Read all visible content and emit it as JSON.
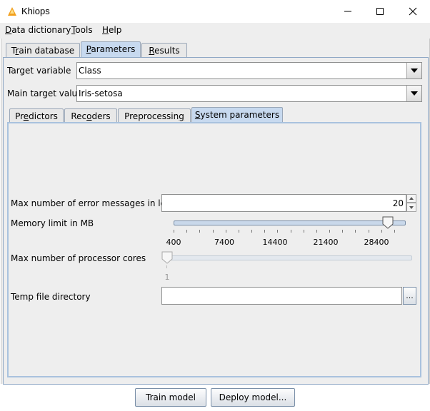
{
  "window": {
    "title": "Khiops",
    "icon": "khiops-logo-icon"
  },
  "window_controls": {
    "minimize": "minimize-icon",
    "maximize": "maximize-icon",
    "close": "close-icon"
  },
  "menubar": {
    "data_dictionary": {
      "mnemonic": "D",
      "rest": "ata dictionary"
    },
    "tools": {
      "mnemonic": "T",
      "rest": "ools"
    },
    "help": {
      "mnemonic": "H",
      "rest": "elp"
    }
  },
  "main_tabs": [
    {
      "pre": "T",
      "mn": "r",
      "post": "ain database",
      "active": false
    },
    {
      "pre": "",
      "mn": "P",
      "post": "arameters",
      "active": true
    },
    {
      "pre": "",
      "mn": "R",
      "post": "esults",
      "active": false
    }
  ],
  "target_variable": {
    "label": "Target variable",
    "value": "Class"
  },
  "main_target_value": {
    "label": "Main target value",
    "value": "Iris-setosa"
  },
  "sub_tabs": [
    {
      "pre": "Pr",
      "mn": "e",
      "post": "dictors",
      "active": false
    },
    {
      "pre": "Rec",
      "mn": "o",
      "post": "ders",
      "active": false
    },
    {
      "pre": "Preprocessin",
      "mn": "g",
      "post": "",
      "active": false
    },
    {
      "pre": "",
      "mn": "S",
      "post": "ystem parameters",
      "active": true
    }
  ],
  "system_parameters": {
    "max_error_messages": {
      "label": "Max number of error messages in log",
      "value": "20"
    },
    "memory_limit": {
      "label": "Memory limit in MB",
      "tick_labels": [
        "400",
        "7400",
        "14400",
        "21400",
        "28400"
      ],
      "min": 400,
      "max": 31500,
      "value": 29300
    },
    "processor_cores": {
      "label": "Max number of processor cores",
      "tick_label": "1",
      "value": 1
    },
    "temp_dir": {
      "label": "Temp file directory",
      "value": "",
      "browse_label": "..."
    }
  },
  "buttons": {
    "train": "Train model",
    "deploy": "Deploy model..."
  }
}
